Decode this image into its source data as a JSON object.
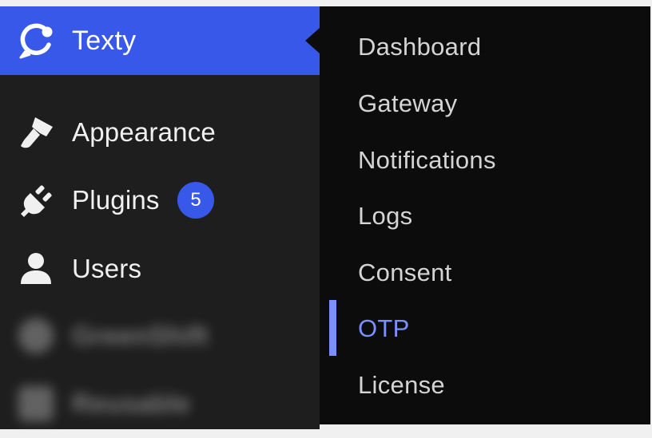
{
  "sidebar": {
    "items": [
      {
        "label": "Texty",
        "icon": "texty-logo-icon",
        "active": true
      },
      {
        "label": "Appearance",
        "icon": "paintbrush-icon"
      },
      {
        "label": "Plugins",
        "icon": "plug-icon",
        "badge": "5"
      },
      {
        "label": "Users",
        "icon": "user-icon"
      },
      {
        "label": "GreenShift",
        "icon": "blurred-icon",
        "blurred": true
      },
      {
        "label": "Reusable",
        "icon": "blurred-icon",
        "blurred": true
      }
    ]
  },
  "submenu": {
    "items": [
      {
        "label": "Dashboard"
      },
      {
        "label": "Gateway"
      },
      {
        "label": "Notifications"
      },
      {
        "label": "Logs"
      },
      {
        "label": "Consent"
      },
      {
        "label": "OTP",
        "current": true
      },
      {
        "label": "License"
      }
    ]
  },
  "colors": {
    "accent": "#3858e9",
    "current_submenu": "#7b90ff",
    "sidebar_bg": "#1e1e1e",
    "submenu_bg": "#0c0c0c"
  }
}
